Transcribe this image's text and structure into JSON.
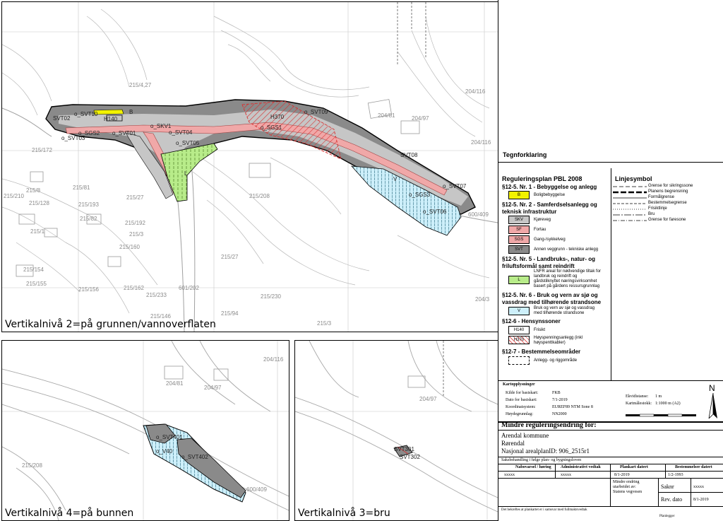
{
  "panels": {
    "main_caption": "Vertikalnivå 2=på grunnen/vannoverflaten",
    "bottom_caption": "Vertikalnivå 4=på bunnen",
    "bridge_caption": "Vertikalnivå 3=bru"
  },
  "map_labels": {
    "svt02": "SVT02",
    "svt10": "o_SVT10",
    "h140": "H140",
    "skv1": "o_SKV1",
    "sgs2": "o_SGS2",
    "svt01": "o_SVT01",
    "svt03": "o_SVT03",
    "svt04": "o_SVT04",
    "svt05": "o_SVT05",
    "l": "L",
    "h370": "H370",
    "svt09": "o_SVT09",
    "sgs1": "o_SGS1",
    "svt08": "SVT08",
    "svt07": "o_SVT07",
    "sgs3": "o_SGS3",
    "svt06": "o_SVT06",
    "b": "B",
    "v": "V",
    "svt401": "o_SVT401",
    "v40": "o_V40",
    "svt402": "o_SVT402",
    "svt301": "SVT301",
    "svt302": "SVT302"
  },
  "parcels": {
    "p1": "215/4,27",
    "p2": "204/81",
    "p3": "204/97",
    "p4": "204/116",
    "p5": "215/172",
    "p6": "215/81",
    "p7": "215/27",
    "p8": "215/208",
    "p9": "215/210",
    "p10": "215/82",
    "p11": "215/192",
    "p12": "215/3",
    "p13": "215/160",
    "p14": "215/154",
    "p15": "215/155",
    "p16": "215/156",
    "p17": "215/162",
    "p18": "215/233",
    "p19": "601/202",
    "p20": "215/230",
    "p21": "215/94",
    "p22": "215/3",
    "p23": "204/3",
    "p24": "600/409",
    "p25": "215/27",
    "p26": "215/146",
    "p27": "204/116",
    "p28": "204/81",
    "p29": "204/97",
    "p30": "215/208",
    "p31": "600/409",
    "p32": "204/97",
    "p33": "215/8",
    "p34": "215/193",
    "p35": "215/1",
    "p36": "215/128"
  },
  "legend": {
    "heading": "Tegnforklaring",
    "plan_title": "Reguleringsplan PBL 2008",
    "s1": "§12-5. Nr. 1 - Bebyggelse og anlegg",
    "b_code": "B",
    "b_text": "Boligbebyggelse",
    "s2a": "§12-5. Nr. 2 - Samferdselsanlegg og",
    "s2b": "teknisk infrastruktur",
    "skv_code": "SKV",
    "skv_text": "Kjøreveg",
    "sf_code": "SF",
    "sf_text": "Fortau",
    "sgs_code": "SGS",
    "sgs_text": "Gang-/sykkelveg",
    "svt_code": "SVT",
    "svt_text": "Annen veggrunn - tekniske anlegg",
    "s5a": "§12-5. Nr. 5 - Landbruks-, natur- og",
    "s5b": "friluftsformål samt reindrift",
    "l_code": "L",
    "l_text1": "LNFR areal for nødvendige tiltak for",
    "l_text2": "landbruk og reindrift og",
    "l_text3": "gårdstilknyttet næringsvirksomhet",
    "l_text4": "basert på gårdens ressursgrunnlag",
    "s6a": "§12-5. Nr. 6 - Bruk og vern av sjø og",
    "s6b": "vassdrag med tilhørende strandsone",
    "v_code": "V",
    "v_text1": "Bruk og vern av sjø og vassdrag",
    "v_text2": "med tilhørende strandsone",
    "s126": "§12-6 - Hensynssoner",
    "h140_code": "H140",
    "h140_text": "Frisikt",
    "h370_code": "H370",
    "h370_text1": "Høyspenningsanlegg (inkl",
    "h370_text2": "høyspenttkabler)",
    "s127": "§12-7 - Bestemmelseområder",
    "area_text": "Anlegg- og riggområde",
    "linesym_title": "Linjesymbol",
    "ls1": "Grense for sikringssone",
    "ls2": "Planens begrensning",
    "ls3": "Formålgrense",
    "ls4": "Bestemmelsegrense",
    "ls5": "Frisiktlinje",
    "ls6": "Bru",
    "ls7": "Grense for faresone"
  },
  "titleblock": {
    "kartopp": "Kartopplysninger",
    "k1_l": "Kilde for basiskart:",
    "k1_v": "FKB",
    "k2_l": "Dato for basiskart:",
    "k2_v": "7/1-2019",
    "k3_l": "Koordinatsystem:",
    "k3_v": "EUREF89 NTM Sone 8",
    "k4_l": "Høydegrunnlag:",
    "k4_v": "NN2000",
    "ekv_l": "Ekvidistanse:",
    "ekv_v": "1 m",
    "mal_l": "Kartmålestokk:",
    "mal_v": "1:1000 m (A2)",
    "north": "N",
    "scale_ticks": [
      "0",
      "10",
      "20",
      "30",
      "40",
      "50"
    ],
    "heading": "Mindre reguleringsendring for:",
    "kommune": "Arendal kommune",
    "sted": "Rørendal",
    "planid": "Nasjonal arealplanID: 906_2515r1",
    "saksbeh": "Saksbehandling i følge plan- og bygningsloven",
    "col1": "Nabovarsel / høring",
    "col2": "Administrativt vedtak",
    "col3": "Plankart datert",
    "col4": "Bestemmelser datert",
    "v1": "xxxxx",
    "v2": "xxxxx",
    "v3": "8/1-2019",
    "v4": "1/2-1993",
    "mindre1": "Mindre endring",
    "mindre2": "utarbeidet av:",
    "mindre3": "Statens vegvesen",
    "saknr_l": "Saknr",
    "saknr_v": "xxxxx",
    "revdato_l": "Rev. dato",
    "revdato_v": "8/1-2019",
    "footer": "Det bekreftes at plankartet er i samsvar med fullmaktsvedtak",
    "planlegger": "Planlegger"
  }
}
